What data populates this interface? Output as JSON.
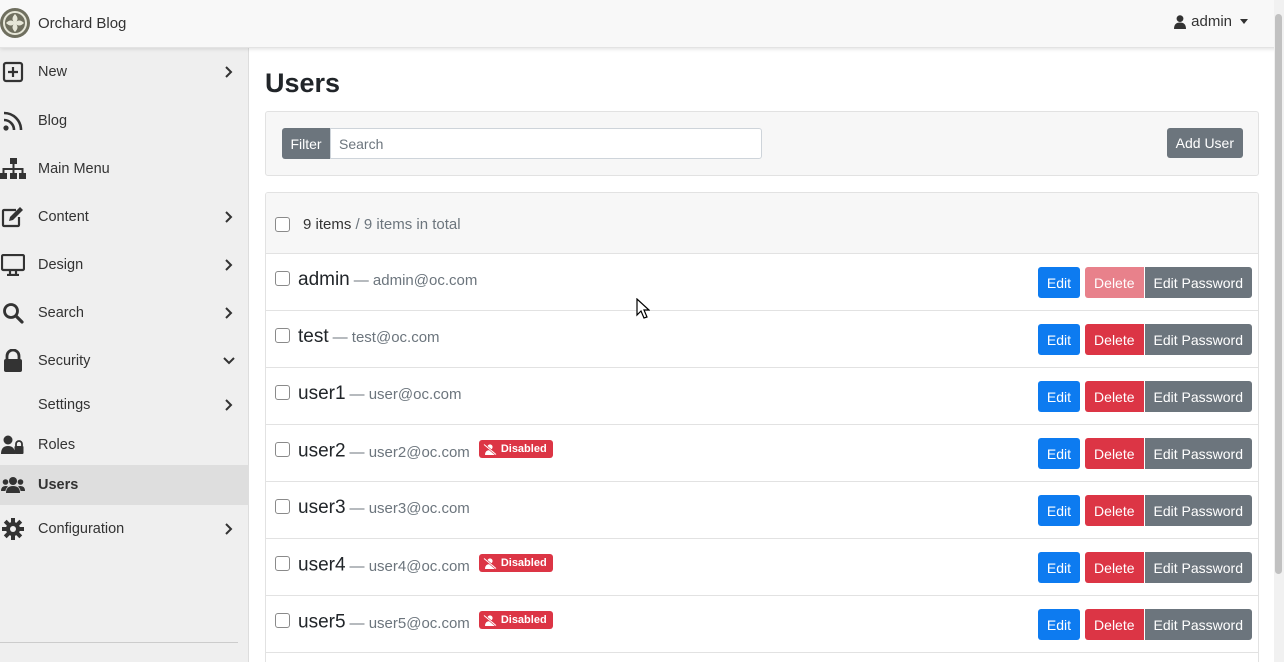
{
  "app": {
    "title": "Orchard Blog"
  },
  "user_menu": {
    "label": "admin"
  },
  "sidebar": {
    "items": [
      {
        "label": "New",
        "icon": "plus-square-icon",
        "chevron": "right"
      },
      {
        "label": "Blog",
        "icon": "rss-icon",
        "chevron": ""
      },
      {
        "label": "Main Menu",
        "icon": "sitemap-icon",
        "chevron": ""
      },
      {
        "label": "Content",
        "icon": "edit-icon",
        "chevron": "right"
      },
      {
        "label": "Design",
        "icon": "desktop-icon",
        "chevron": "right"
      },
      {
        "label": "Search",
        "icon": "search-icon",
        "chevron": "right"
      },
      {
        "label": "Security",
        "icon": "lock-icon",
        "chevron": "down"
      },
      {
        "label": "Settings",
        "icon": "",
        "chevron": "right"
      },
      {
        "label": "Roles",
        "icon": "user-lock-icon",
        "chevron": ""
      },
      {
        "label": "Users",
        "icon": "users-icon",
        "chevron": "",
        "active": true
      },
      {
        "label": "Configuration",
        "icon": "gear-icon",
        "chevron": "right"
      }
    ]
  },
  "page": {
    "title": "Users"
  },
  "filter": {
    "label": "Filter",
    "placeholder": "Search",
    "value": "",
    "add_button": "Add User"
  },
  "list": {
    "count": "9 items",
    "total": " / 9 items in total",
    "separator": "—",
    "actions": {
      "edit": "Edit",
      "delete": "Delete",
      "edit_password": "Edit Password"
    },
    "disabled_label": "Disabled",
    "users": [
      {
        "name": "admin",
        "email": "admin@oc.com",
        "disabled": false,
        "delete_disabled": true
      },
      {
        "name": "test",
        "email": "test@oc.com",
        "disabled": false,
        "delete_disabled": false
      },
      {
        "name": "user1",
        "email": "user@oc.com",
        "disabled": false,
        "delete_disabled": false
      },
      {
        "name": "user2",
        "email": "user2@oc.com",
        "disabled": true,
        "delete_disabled": false
      },
      {
        "name": "user3",
        "email": "user3@oc.com",
        "disabled": false,
        "delete_disabled": false
      },
      {
        "name": "user4",
        "email": "user4@oc.com",
        "disabled": true,
        "delete_disabled": false
      },
      {
        "name": "user5",
        "email": "user5@oc.com",
        "disabled": true,
        "delete_disabled": false
      }
    ]
  },
  "colors": {
    "primary": "#0d7bf0",
    "danger": "#dc3545",
    "secondary": "#6c757d"
  }
}
